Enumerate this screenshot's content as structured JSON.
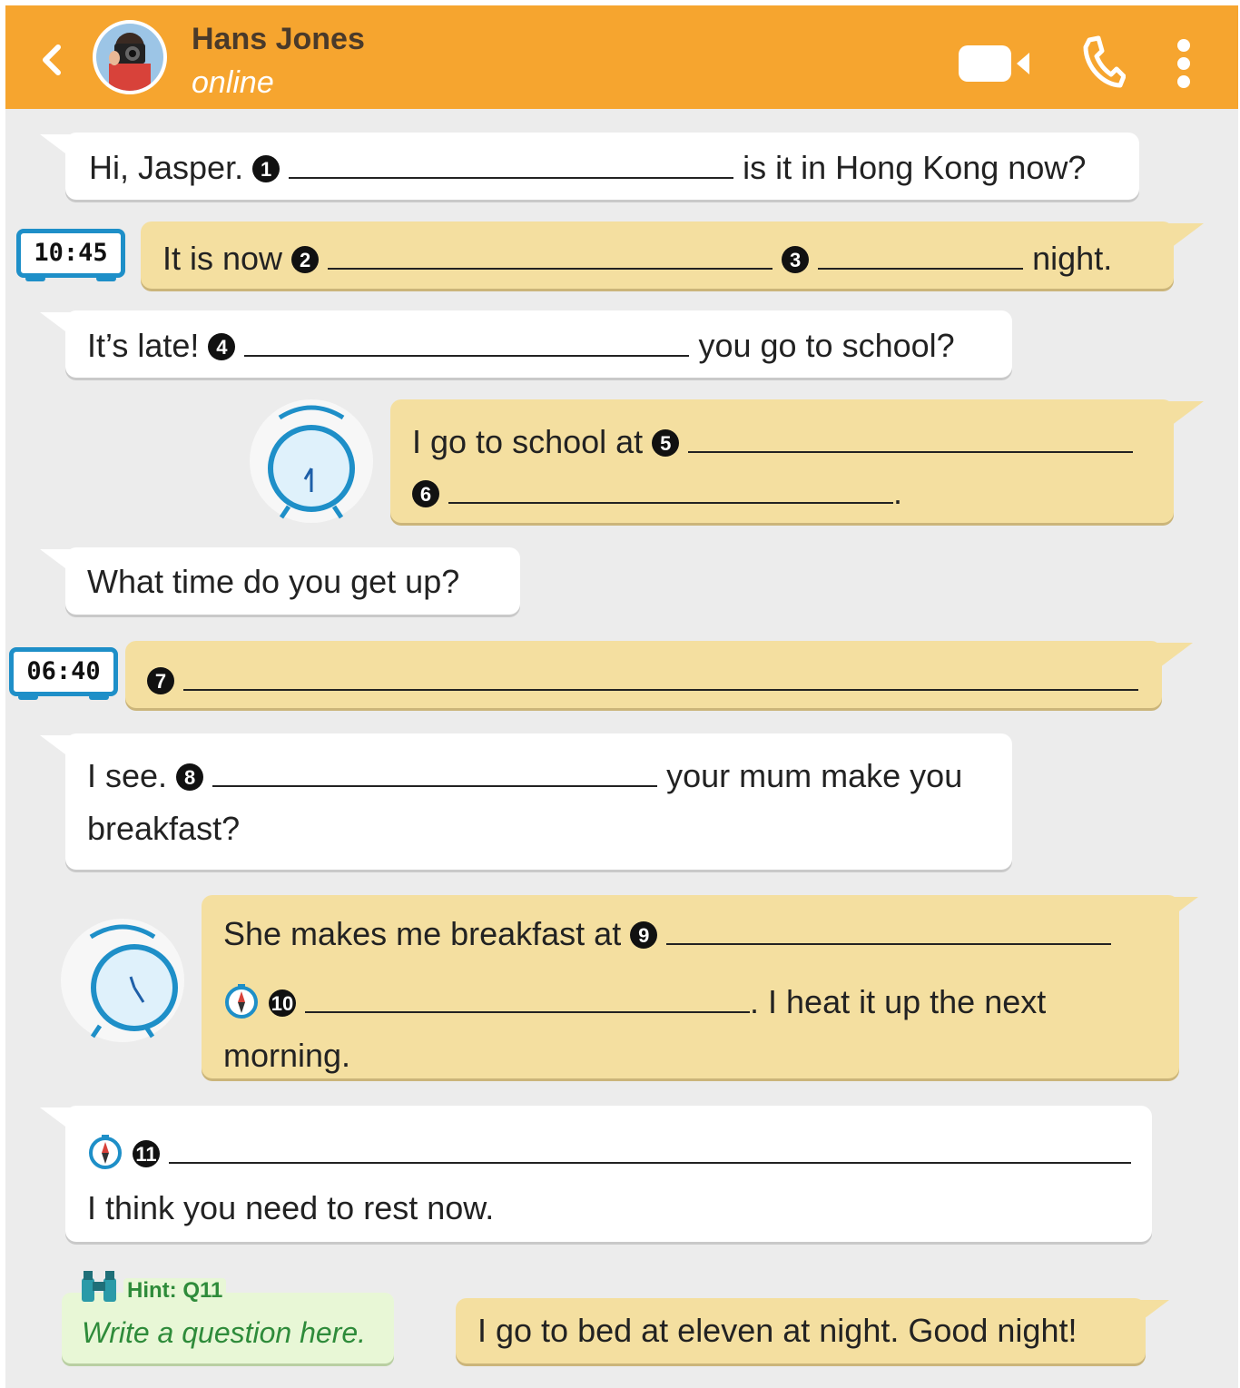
{
  "header": {
    "contact_name": "Hans Jones",
    "status": "online",
    "icons": [
      "back-chevron-icon",
      "video-call-icon",
      "phone-icon",
      "more-vert-icon"
    ],
    "color": "#f6a52f"
  },
  "messages": [
    {
      "side": "in",
      "parts": {
        "a": "Hi, Jasper.",
        "n1": "1",
        "b": "is it in Hong Kong now?"
      }
    },
    {
      "side": "out",
      "clock": "10:45",
      "parts": {
        "a": "It is now",
        "n2": "2",
        "n3": "3",
        "b": "night."
      }
    },
    {
      "side": "in",
      "parts": {
        "a": "It’s late!",
        "n4": "4",
        "b": "you go to school?"
      }
    },
    {
      "side": "out",
      "parts": {
        "a": "I go to school at",
        "n5": "5",
        "n6": "6",
        "end": "."
      }
    },
    {
      "side": "in",
      "text": "What time do you get up?"
    },
    {
      "side": "out",
      "clock": "06:40",
      "parts": {
        "n7": "7"
      }
    },
    {
      "side": "in",
      "parts": {
        "a": "I see.",
        "n8": "8",
        "b": "your mum make you",
        "c": "breakfast?"
      }
    },
    {
      "side": "out",
      "parts": {
        "a": "She makes me breakfast at",
        "n9": "9",
        "n10": "10",
        "b": ". I heat it up the next",
        "c": "morning."
      }
    },
    {
      "side": "in",
      "parts": {
        "n11": "11",
        "b": "I think you need to rest now."
      }
    },
    {
      "side": "out",
      "text": "I go to bed at eleven at night. Good night!"
    }
  ],
  "hint": {
    "label": "Hint: Q11",
    "text": "Write a question here."
  },
  "colors": {
    "incoming": "#ffffff",
    "outgoing": "#f4dfa0",
    "background": "#ececec",
    "clock": "#1e8fc8"
  }
}
